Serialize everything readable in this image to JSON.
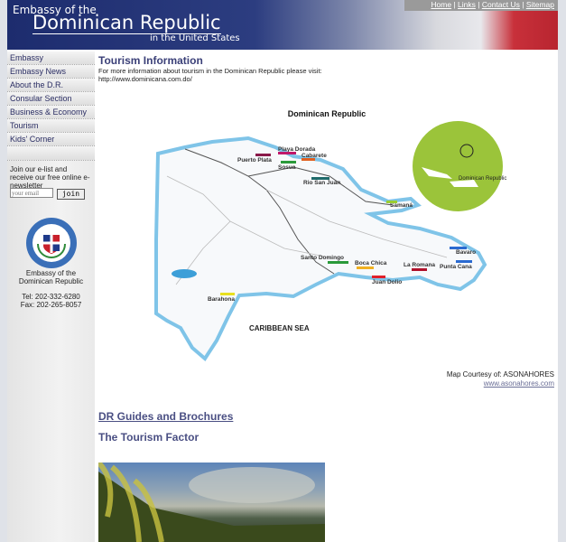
{
  "header": {
    "line1": "Embassy of the",
    "line2": "Dominican Republic",
    "line3": "in the United States"
  },
  "toplinks": [
    "Home",
    "Links",
    "Contact Us",
    "Sitemap"
  ],
  "sidebar": {
    "items": [
      "Embassy",
      "Embassy News",
      "About the D.R.",
      "Consular Section",
      "Business & Economy",
      "Tourism",
      "Kids' Corner"
    ],
    "elist": "Join our e-list and receive our free online e-newsletter",
    "email_placeholder": "your email",
    "join": "join",
    "addr1": "Embassy of the",
    "addr2": "Dominican Republic",
    "tel": "Tel: 202-332-6280",
    "fax": "Fax: 202-265-8057"
  },
  "main": {
    "title": "Tourism Information",
    "intro": "For more information about tourism in the Dominican Republic please visit:",
    "url": "http://www.dominicana.com.do/",
    "map": {
      "title": "Dominican Republic",
      "sea": "CARIBBEAN SEA",
      "inset": "Dominican Republic",
      "places": [
        "Playa Dorada",
        "Puerto Plata",
        "Cabarete",
        "Sosua",
        "Rio San Juan",
        "Samaná",
        "Santo Domingo",
        "Boca Chica",
        "La Romana",
        "Bavaro",
        "Punta Cana",
        "Juan Dolio",
        "Barahona"
      ]
    },
    "courtesy": "Map Courtesy of: ASONAHORES",
    "courtesy_link": "www.asonahores.com",
    "guides": "DR Guides and Brochures",
    "factor": "The Tourism Factor"
  }
}
